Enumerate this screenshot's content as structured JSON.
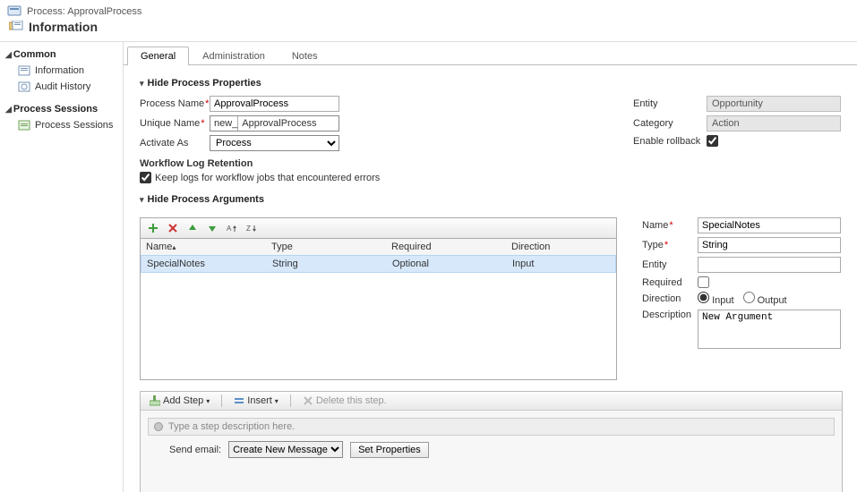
{
  "header": {
    "context_line": "Process: ApprovalProcess",
    "title": "Information"
  },
  "sidebar": {
    "sections": [
      {
        "heading": "Common",
        "items": [
          "Information",
          "Audit History"
        ]
      },
      {
        "heading": "Process Sessions",
        "items": [
          "Process Sessions"
        ]
      }
    ]
  },
  "tabs": [
    "General",
    "Administration",
    "Notes"
  ],
  "properties_section": {
    "title": "Hide Process Properties",
    "process_name_label": "Process Name",
    "process_name_value": "ApprovalProcess",
    "unique_name_label": "Unique Name",
    "unique_name_prefix": "new_",
    "unique_name_value": "ApprovalProcess",
    "activate_as_label": "Activate As",
    "activate_as_value": "Process",
    "log_heading": "Workflow Log Retention",
    "log_checkbox_label": "Keep logs for workflow jobs that encountered errors",
    "entity_label": "Entity",
    "entity_value": "Opportunity",
    "category_label": "Category",
    "category_value": "Action",
    "rollback_label": "Enable rollback"
  },
  "arguments_section": {
    "title": "Hide Process Arguments",
    "grid_headers": {
      "name": "Name",
      "type": "Type",
      "required": "Required",
      "direction": "Direction"
    },
    "rows": [
      {
        "name": "SpecialNotes",
        "type": "String",
        "required": "Optional",
        "direction": "Input"
      }
    ],
    "form": {
      "name_label": "Name",
      "name_value": "SpecialNotes",
      "type_label": "Type",
      "type_value": "String",
      "entity_label": "Entity",
      "entity_value": "",
      "required_label": "Required",
      "direction_label": "Direction",
      "direction_input": "Input",
      "direction_output": "Output",
      "description_label": "Description",
      "description_value": "New Argument"
    }
  },
  "designer": {
    "add_step": "Add Step",
    "insert": "Insert",
    "delete": "Delete this step.",
    "step_placeholder": "Type a step description here.",
    "action_label": "Send email:",
    "action_select": "Create New Message",
    "set_properties": "Set Properties"
  }
}
